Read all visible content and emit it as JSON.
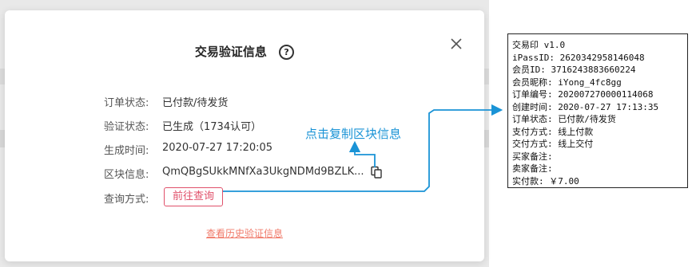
{
  "modal": {
    "title": "交易验证信息",
    "help_icon": "question-circle-icon",
    "close_icon": "close-icon",
    "rows": [
      {
        "label": "订单状态:",
        "value": "已付款/待发货"
      },
      {
        "label": "验证状态:",
        "value": "已生成（1734认可）"
      },
      {
        "label": "生成时间:",
        "value": "2020-07-27 17:20:05"
      },
      {
        "label": "区块信息:",
        "value": "QmQBgSUkkMNfXa3UkgNDMd9BZLK..."
      },
      {
        "label": "查询方式:",
        "button": "前往查询"
      }
    ],
    "history_link": "查看历史验证信息"
  },
  "annotation": {
    "text": "点击复制区块信息"
  },
  "receipt": {
    "lines": [
      "交易印 v1.0",
      "iPassID: 2620342958146048",
      "会员ID: 3716243883660224",
      "会员昵称: iYong_4fc8gg",
      "订单编号: 202007270000114068",
      "创建时间: 2020-07-27 17:13:35",
      "订单状态: 已付款/待发货",
      "支付方式: 线上付款",
      "交付方式: 线上交付",
      "买家备注:",
      "卖家备注:",
      "实付款: ￥7.00"
    ]
  },
  "colors": {
    "accent": "#1a93d6",
    "button": "#e0506a",
    "link": "#f07a6a"
  }
}
